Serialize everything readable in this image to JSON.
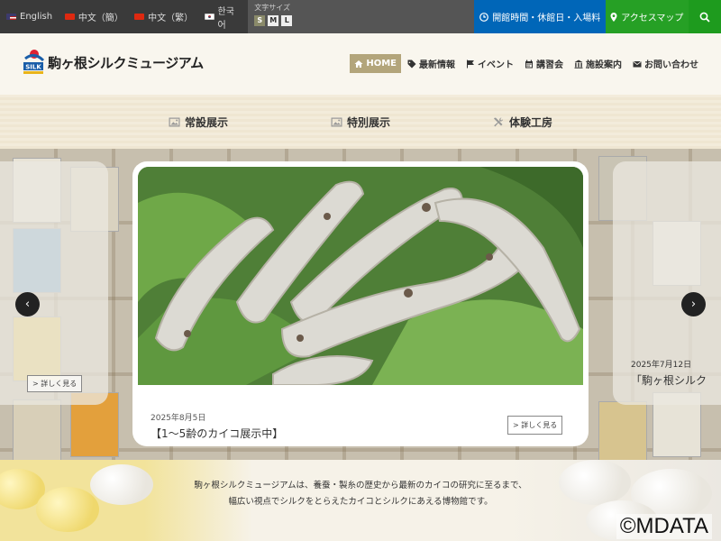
{
  "topbar": {
    "languages": [
      {
        "label": "English",
        "flag": "us-flag-icon"
      },
      {
        "label": "中文（簡）",
        "flag": "cn-flag-icon"
      },
      {
        "label": "中文（繁）",
        "flag": "tw-flag-icon"
      },
      {
        "label": "한국어",
        "flag": "kr-flag-icon"
      }
    ],
    "font_size": {
      "label": "文字サイズ",
      "options": [
        "S",
        "M",
        "L"
      ],
      "selected": "S"
    },
    "hours_label": "開館時間・休館日・入場料",
    "access_label": "アクセスマップ",
    "colors": {
      "dark": "#3a3a3a",
      "blue": "#0066b8",
      "green": "#26a025"
    }
  },
  "header": {
    "logo_text": "駒ヶ根シルクミュージアム",
    "nav": [
      {
        "label": "HOME",
        "icon": "home-icon",
        "active": true
      },
      {
        "label": "最新情報",
        "icon": "tag-icon"
      },
      {
        "label": "イベント",
        "icon": "flag-icon"
      },
      {
        "label": "講習会",
        "icon": "calendar-icon"
      },
      {
        "label": "施設案内",
        "icon": "building-icon"
      },
      {
        "label": "お問い合わせ",
        "icon": "mail-icon"
      }
    ],
    "accent": "#b3a57b"
  },
  "subnav": [
    {
      "label": "常設展示",
      "icon": "image-icon"
    },
    {
      "label": "特別展示",
      "icon": "image-icon"
    },
    {
      "label": "体験工房",
      "icon": "tools-icon"
    }
  ],
  "slider": {
    "main": {
      "date": "2025年8月5日",
      "title": "【1～5齢のカイコ展示中】",
      "more": "> 詳しく見る"
    },
    "left": {
      "more": "> 詳しく見る"
    },
    "right": {
      "date": "2025年7月12日",
      "title": "「駒ヶ根シルク"
    }
  },
  "intro": {
    "line1": "駒ヶ根シルクミュージアムは、養蚕・製糸の歴史から最新のカイコの研究に至るまで、",
    "line2": "幅広い視点でシルクをとらえたカイコとシルクにあえる博物館です。",
    "copyright": "©MDATA"
  }
}
